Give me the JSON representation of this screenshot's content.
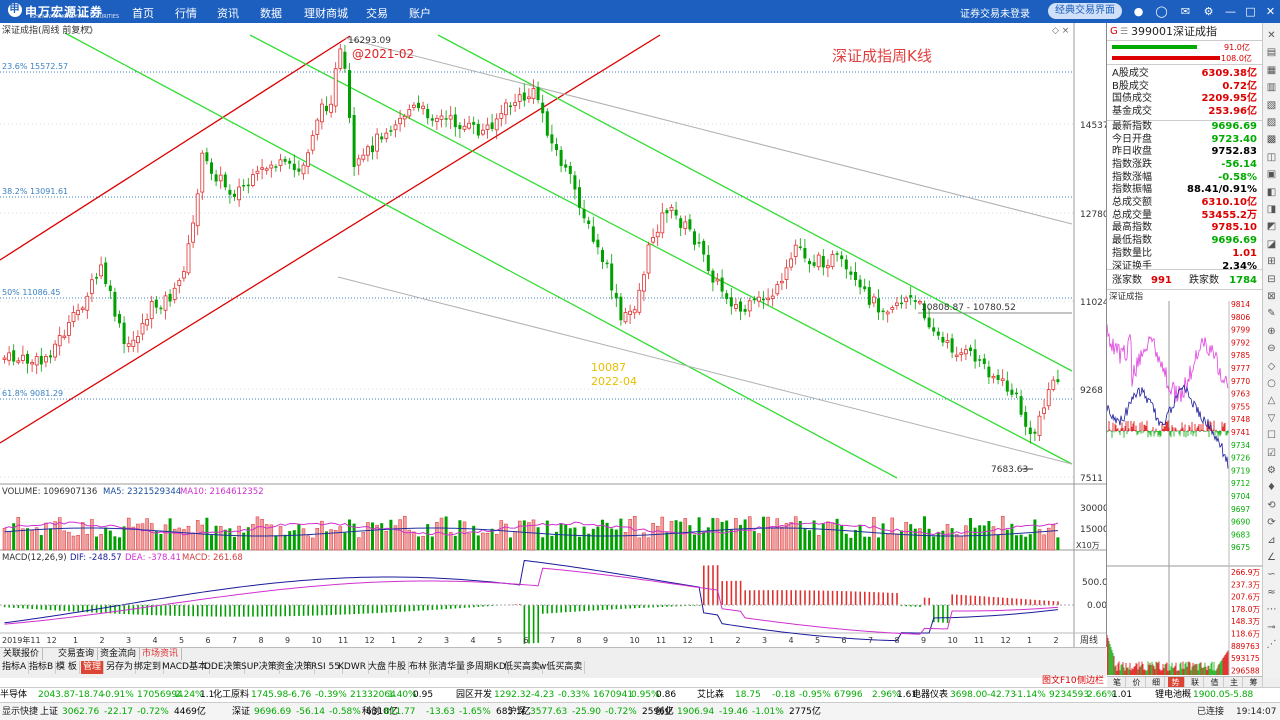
{
  "topnav": {
    "brand": "申万宏源证券",
    "brand_sub": "SHENWAN HONGYUAN SECURITIES",
    "items": [
      "首页",
      "行情",
      "资讯",
      "数据",
      "理财商城",
      "交易",
      "账户"
    ],
    "login_status": "证券交易未登录",
    "classic_button": "经典交易界面",
    "icons": [
      "user-icon",
      "headset-icon",
      "mail-icon",
      "settings-icon",
      "minimize-icon",
      "maximize-icon",
      "close-icon"
    ]
  },
  "chart": {
    "title": "深证成指(周线 前复权)",
    "annotation_title": "深证成指周K线",
    "peak_label": "16293.09",
    "peak_date_label": "@2021-02",
    "low_value": "10087",
    "low_date": "2022-04",
    "range_label": "10808.87 - 10780.52",
    "min_label": "7683.63",
    "fib_levels": [
      "23.6% 15572.57",
      "38.2% 13091.61",
      "50% 11086.45",
      "61.8% 9081.29"
    ],
    "y_ticks": [
      "14537",
      "12780",
      "11024",
      "9268",
      "7511"
    ],
    "colors": {
      "up": "#e03030",
      "down": "#00a000",
      "channel_green": "#33dd33",
      "channel_red": "#dd0000",
      "trend_gray": "#b0b0b0",
      "fib": "#3b82c4"
    }
  },
  "volume": {
    "header": "VOLUME: 1096907136",
    "ma5": "MA5: 2321529344",
    "ma10": "MA10: 2164612352",
    "ticks": [
      "30000",
      "15000"
    ],
    "unit": "X10万"
  },
  "macd": {
    "header": "MACD(12,26,9)",
    "dif": "DIF: -248.57",
    "dea": "DEA: -378.41",
    "macd": "MACD: 261.68",
    "ticks": [
      "500.0",
      "0.00"
    ]
  },
  "time_axis": [
    "2019年11",
    "12",
    "1",
    "2",
    "3",
    "4",
    "5",
    "6",
    "7",
    "8",
    "9",
    "10",
    "11",
    "12",
    "1",
    "2",
    "3",
    "4",
    "5",
    "6",
    "7",
    "8",
    "9",
    "10",
    "11",
    "12",
    "1",
    "2",
    "3",
    "4",
    "5",
    "6",
    "7",
    "8",
    "9",
    "10",
    "11",
    "12",
    "1",
    "2"
  ],
  "period_label": "周线",
  "bottom_tabs_row1": [
    "关联报价",
    "交易查询",
    "资金流向",
    "市场资讯"
  ],
  "bottom_tabs_row2": [
    "指标A",
    "指标B",
    "模 板",
    "管理",
    "另存为",
    "绑定到",
    "MACD基本",
    "DDE决策",
    "SUP决策",
    "资金决策",
    "RSI 55",
    "KDWR",
    "大盘",
    "牛股",
    "布林",
    "张清华量",
    "多周期KD",
    "低买高卖",
    "w低买高卖"
  ],
  "right_panel": {
    "code": "399001",
    "name": "深证成指",
    "bar_labels": [
      "91.0亿",
      "108.0亿"
    ],
    "rows": [
      {
        "label": "A股成交",
        "value": "6309.38亿",
        "color": "red"
      },
      {
        "label": "B股成交",
        "value": "0.72亿",
        "color": "red"
      },
      {
        "label": "国债成交",
        "value": "2209.95亿",
        "color": "red"
      },
      {
        "label": "基金成交",
        "value": "253.96亿",
        "color": "red"
      },
      {
        "label": "最新指数",
        "value": "9696.69",
        "color": "green"
      },
      {
        "label": "今日开盘",
        "value": "9723.40",
        "color": "green"
      },
      {
        "label": "昨日收盘",
        "value": "9752.83",
        "color": "black"
      },
      {
        "label": "指数涨跌",
        "value": "-56.14",
        "color": "green"
      },
      {
        "label": "指数涨幅",
        "value": "-0.58%",
        "color": "green"
      },
      {
        "label": "指数振幅",
        "value": "88.41/0.91%",
        "color": "black"
      },
      {
        "label": "总成交额",
        "value": "6310.10亿",
        "color": "red"
      },
      {
        "label": "总成交量",
        "value": "53455.2万",
        "color": "red"
      },
      {
        "label": "最高指数",
        "value": "9785.10",
        "color": "red"
      },
      {
        "label": "最低指数",
        "value": "9696.69",
        "color": "green"
      },
      {
        "label": "指数量比",
        "value": "1.01",
        "color": "red"
      },
      {
        "label": "深证换手",
        "value": "2.34%",
        "color": "black"
      }
    ],
    "up_label": "涨家数",
    "up_count": "991",
    "down_label": "跌家数",
    "down_count": "1784",
    "mini_title": "深证成指",
    "mini_ticks": [
      "9814",
      "9806",
      "9799",
      "9792",
      "9785",
      "9777",
      "9770",
      "9763",
      "9755",
      "9748",
      "9741",
      "9734",
      "9726",
      "9719",
      "9712",
      "9704",
      "9697",
      "9690",
      "9683",
      "9675"
    ],
    "mini_vol_ticks": [
      "266.9万",
      "237.3万",
      "207.6万",
      "178.0万",
      "148.3万",
      "118.6万",
      "889763",
      "593175",
      "296588"
    ],
    "tabs": [
      "笔",
      "价",
      "细",
      "势",
      "联",
      "值",
      "主",
      "筹"
    ],
    "active_tab": "势"
  },
  "ticker1": [
    {
      "name": "半导体",
      "v": "2043.87",
      "c": "-18.74",
      "p": "-0.91%",
      "vol": "17056994",
      "x": "2.24%",
      "y": "1.1"
    },
    {
      "name": "化工原料",
      "v": "1745.98",
      "c": "-6.76",
      "p": "-0.39%",
      "vol": "21332064",
      "x": "1.40%",
      "y": "0.95"
    },
    {
      "name": "园区开发",
      "v": "1292.32",
      "c": "-4.23",
      "p": "-0.33%",
      "vol": "1670941",
      "x": "0.95%",
      "y": "0.86"
    },
    {
      "name": "艾比森",
      "v": "18.75",
      "c": "-0.18",
      "p": "-0.95%",
      "vol": "67996",
      "x": "2.96%",
      "y": "1.61"
    },
    {
      "name": "电器仪表",
      "v": "3698.00",
      "c": "-42.73",
      "p": "-1.14%",
      "vol": "9234593",
      "x": "2.66%",
      "y": "1.01"
    },
    {
      "name": "锂电池概",
      "v": "1900.05",
      "c": "-5.88",
      "p": "",
      "vol": "",
      "x": "",
      "y": ""
    }
  ],
  "ticker2": {
    "quick": "显示快捷",
    "items": [
      {
        "name": "上证",
        "v": "3062.76",
        "c": "-22.17",
        "p": "-0.72%",
        "amt": "4469亿"
      },
      {
        "name": "深证",
        "v": "9696.69",
        "c": "-56.14",
        "p": "-0.58%",
        "amt": "6310亿"
      },
      {
        "name": "科创",
        "v": "811.77",
        "c": "-13.63",
        "p": "-1.65%",
        "amt": "685.1亿"
      },
      {
        "name": "沪深",
        "v": "3577.63",
        "c": "-25.90",
        "p": "-0.72%",
        "amt": "2596亿"
      },
      {
        "name": "创业",
        "v": "1906.94",
        "c": "-19.46",
        "p": "-1.01%",
        "amt": "2775亿"
      }
    ],
    "status": "已连接",
    "time": "19:14:07"
  },
  "f10": "图文F10",
  "sidebar_label": "侧边栏"
}
